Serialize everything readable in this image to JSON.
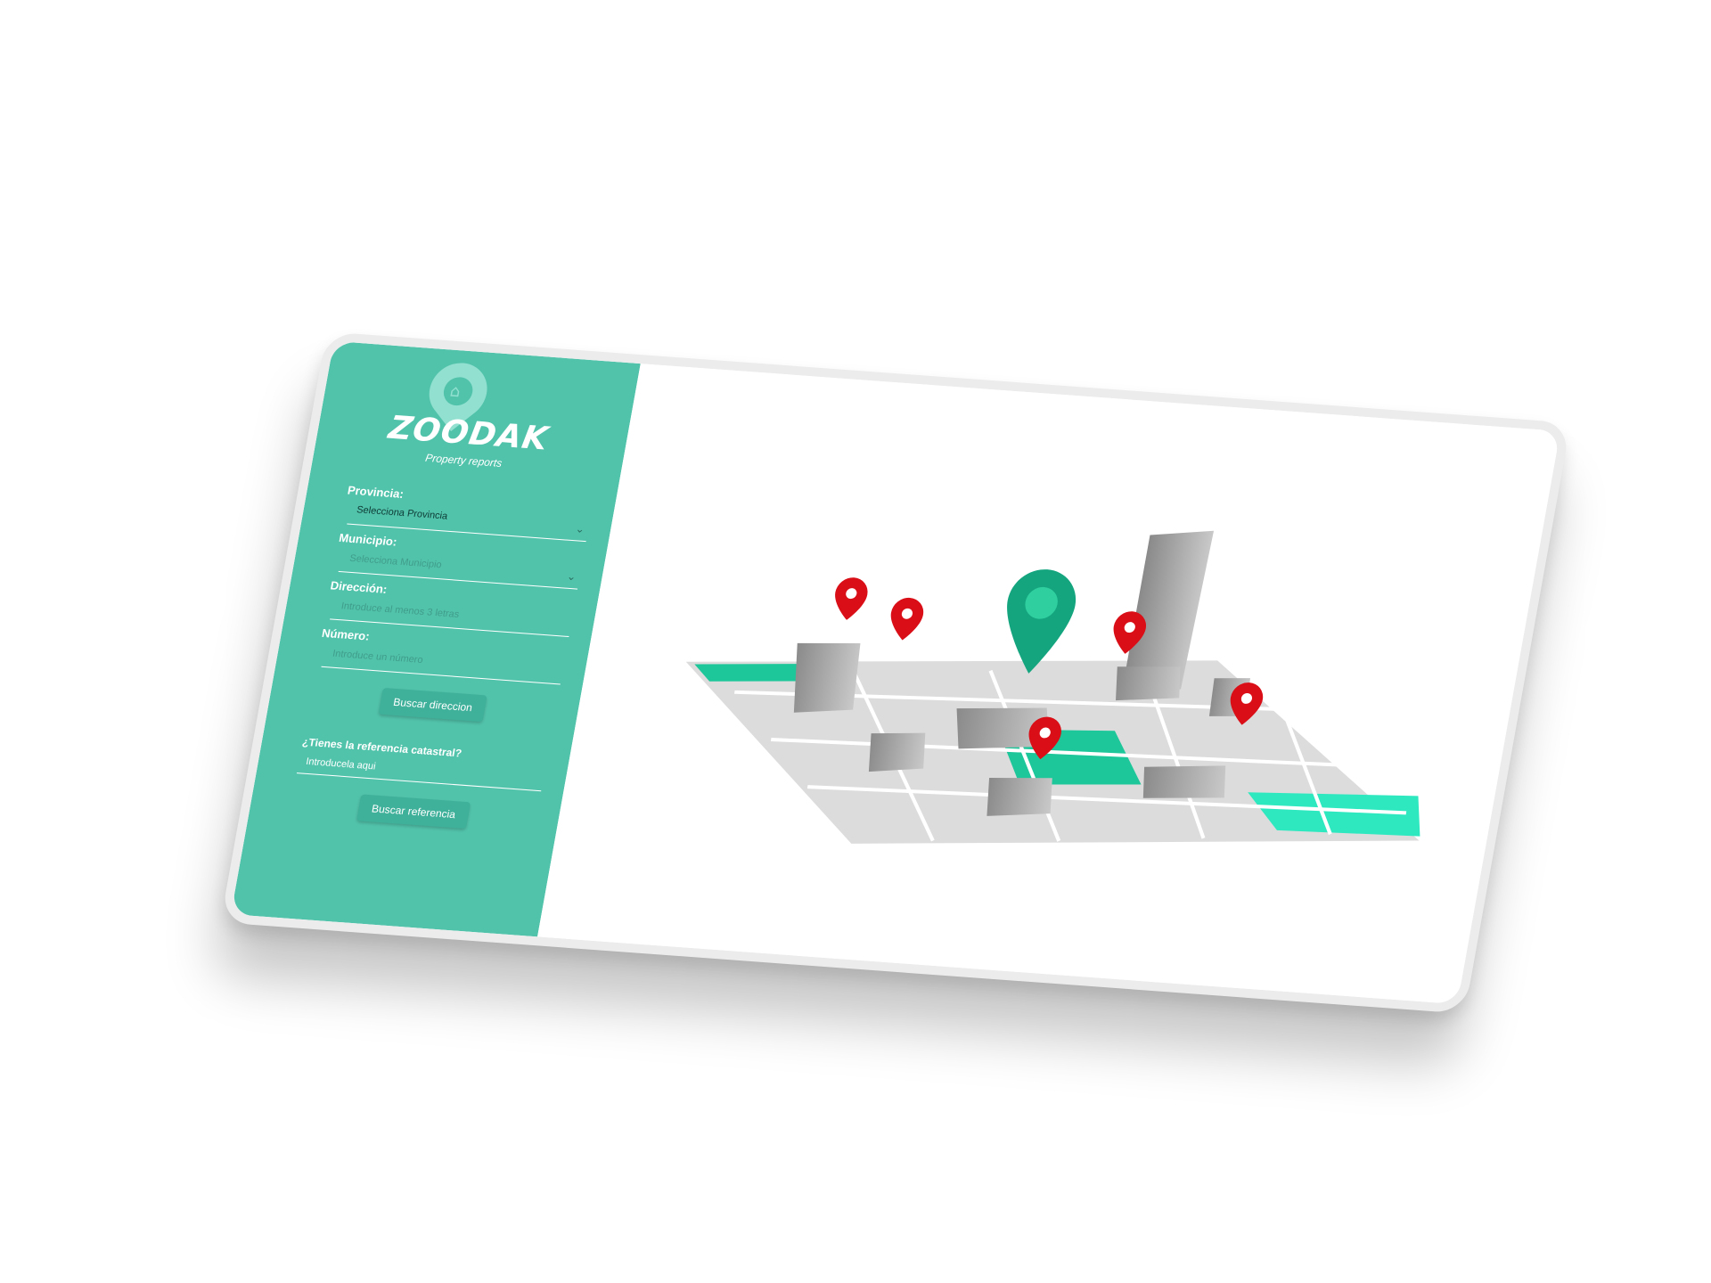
{
  "brand": {
    "name": "ZOODAK",
    "tagline": "Property reports"
  },
  "form": {
    "provincia": {
      "label": "Provincia:",
      "value": "Selecciona Provincia"
    },
    "municipio": {
      "label": "Municipio:",
      "placeholder": "Selecciona Municipio"
    },
    "direccion": {
      "label": "Dirección:",
      "placeholder": "Introduce al menos 3 letras"
    },
    "numero": {
      "label": "Número:",
      "placeholder": "Introduce un número"
    },
    "buscar_direccion": "Buscar direccion",
    "catastral": {
      "label": "¿Tienes la referencia catastral?",
      "placeholder": "Introducela aqui"
    },
    "buscar_referencia": "Buscar referencia"
  },
  "colors": {
    "accent": "#52c3ab",
    "button": "#3fb09a",
    "pin": "#d90e17",
    "map_green": "#1dc79a"
  },
  "icons": {
    "logo": "house-pin-icon",
    "dropdown": "chevron-down-icon",
    "marker": "map-pin-icon"
  }
}
